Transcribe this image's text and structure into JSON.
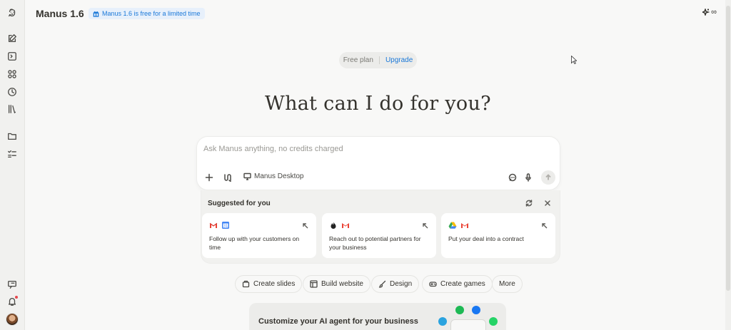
{
  "header": {
    "model_name": "Manus 1.6",
    "promo_badge": "Manus 1.6 is free for a limited time",
    "right_label": "∞"
  },
  "sidebar": {
    "items": [
      {
        "name": "logo-icon"
      },
      {
        "name": "new-task-icon"
      },
      {
        "name": "sidebar-toggle-icon"
      },
      {
        "name": "apps-icon"
      },
      {
        "name": "history-icon"
      },
      {
        "name": "library-icon"
      },
      {
        "name": "folder-icon"
      },
      {
        "name": "tasks-icon"
      },
      {
        "name": "feedback-icon"
      },
      {
        "name": "bell-icon"
      }
    ]
  },
  "plan": {
    "free_label": "Free plan",
    "upgrade_label": "Upgrade"
  },
  "headline": "What can I do for you?",
  "composer": {
    "placeholder": "Ask Manus anything, no credits charged",
    "desktop_label": "Manus Desktop"
  },
  "suggestions": {
    "title": "Suggested for you",
    "cards": [
      {
        "text": "Follow up with your customers on time",
        "icons": [
          "gmail-icon",
          "calendar-icon"
        ]
      },
      {
        "text": "Reach out to potential partners for your business",
        "icons": [
          "flame-icon",
          "gmail-icon"
        ]
      },
      {
        "text": "Put your deal into a contract",
        "icons": [
          "drive-icon",
          "gmail-icon"
        ]
      }
    ]
  },
  "quick_actions": [
    {
      "label": "Create slides",
      "icon": "slides-icon"
    },
    {
      "label": "Build website",
      "icon": "website-icon"
    },
    {
      "label": "Design",
      "icon": "brush-icon"
    },
    {
      "label": "Create games",
      "icon": "gamepad-icon"
    },
    {
      "label": "More",
      "icon": ""
    }
  ],
  "promo_card": {
    "text": "Customize your AI agent for your business"
  },
  "colors": {
    "accent": "#1a78d8",
    "background": "#f8f8f7",
    "sidebar": "#f1f1ef",
    "gmail_red": "#ea4335",
    "drive_green": "#34a853",
    "drive_yellow": "#fbbc04"
  }
}
